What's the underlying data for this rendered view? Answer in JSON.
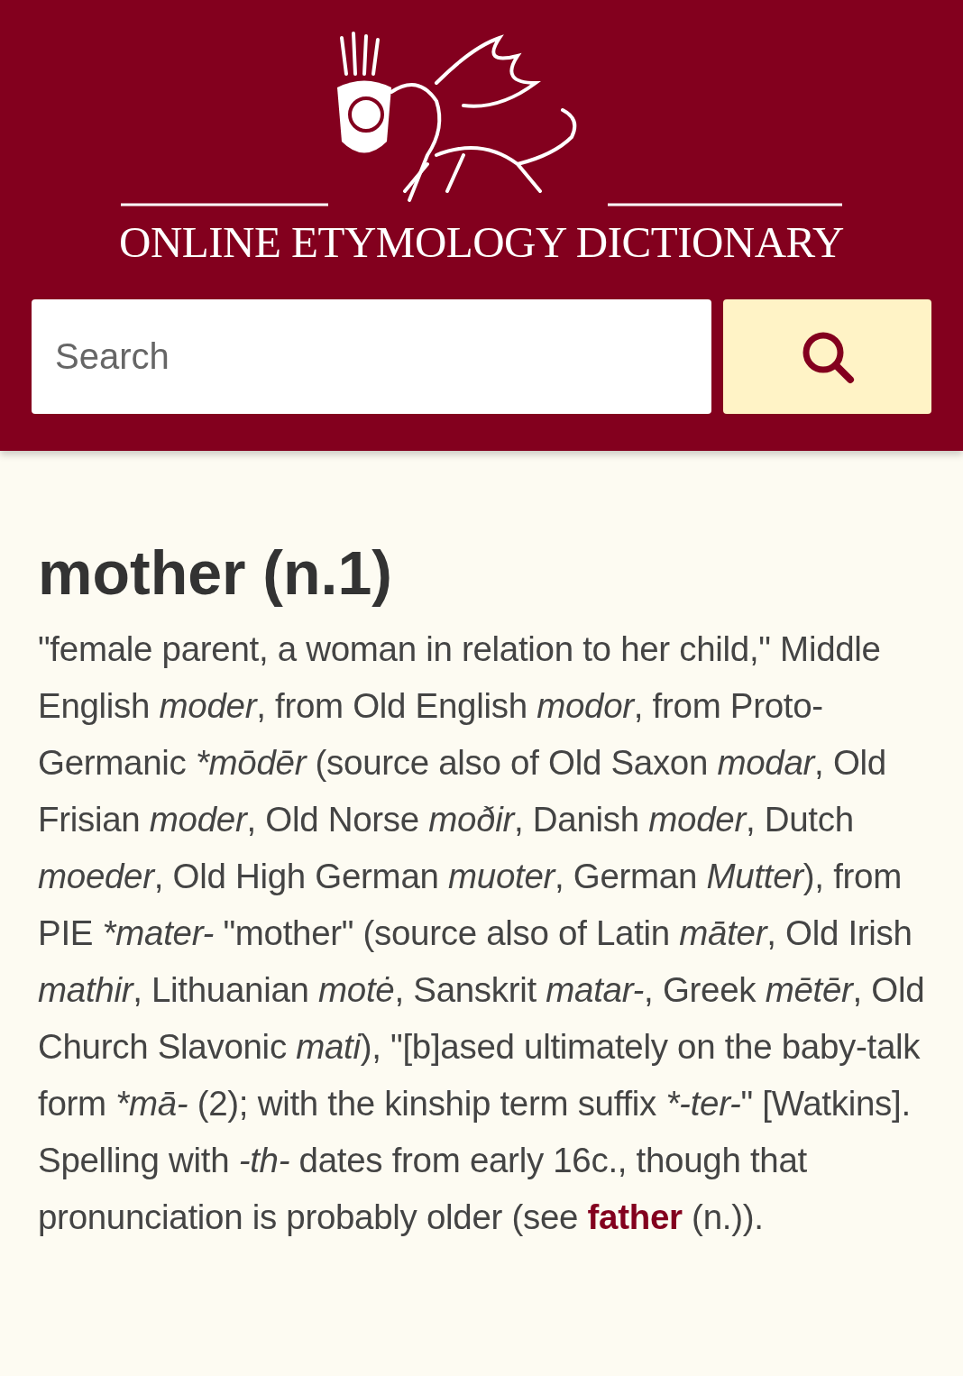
{
  "header": {
    "site_title": "ONLINE ETYMOLOGY DICTIONARY",
    "search": {
      "placeholder": "Search"
    }
  },
  "entry": {
    "heading": "mother (n.1)",
    "segments": [
      {
        "kind": "text",
        "text": "\"female parent, a woman in relation to her child,\" Middle English "
      },
      {
        "kind": "italic",
        "text": "moder"
      },
      {
        "kind": "text",
        "text": ", from Old English "
      },
      {
        "kind": "italic",
        "text": "modor"
      },
      {
        "kind": "text",
        "text": ", from Proto-Germanic "
      },
      {
        "kind": "italic",
        "text": "*mōdēr"
      },
      {
        "kind": "text",
        "text": " (source also of Old Saxon "
      },
      {
        "kind": "italic",
        "text": "modar"
      },
      {
        "kind": "text",
        "text": ", Old Frisian "
      },
      {
        "kind": "italic",
        "text": "moder"
      },
      {
        "kind": "text",
        "text": ", Old Norse "
      },
      {
        "kind": "italic",
        "text": "moðir"
      },
      {
        "kind": "text",
        "text": ", Danish "
      },
      {
        "kind": "italic",
        "text": "moder"
      },
      {
        "kind": "text",
        "text": ", Dutch "
      },
      {
        "kind": "italic",
        "text": "moeder"
      },
      {
        "kind": "text",
        "text": ", Old High German "
      },
      {
        "kind": "italic",
        "text": "muoter"
      },
      {
        "kind": "text",
        "text": ", German "
      },
      {
        "kind": "italic",
        "text": "Mutter"
      },
      {
        "kind": "text",
        "text": "), from PIE "
      },
      {
        "kind": "italic",
        "text": "*mater-"
      },
      {
        "kind": "text",
        "text": " \"mother\" (source also of Latin "
      },
      {
        "kind": "italic",
        "text": "māter"
      },
      {
        "kind": "text",
        "text": ", Old Irish "
      },
      {
        "kind": "italic",
        "text": "mathir"
      },
      {
        "kind": "text",
        "text": ", Lithuanian "
      },
      {
        "kind": "italic",
        "text": "motė"
      },
      {
        "kind": "text",
        "text": ", Sanskrit "
      },
      {
        "kind": "italic",
        "text": "matar-"
      },
      {
        "kind": "text",
        "text": ", Greek "
      },
      {
        "kind": "italic",
        "text": "mētēr"
      },
      {
        "kind": "text",
        "text": ", Old Church Slavonic "
      },
      {
        "kind": "italic",
        "text": "mati"
      },
      {
        "kind": "text",
        "text": "), \"[b]ased ultimately on the baby-talk form "
      },
      {
        "kind": "italic",
        "text": "*mā-"
      },
      {
        "kind": "text",
        "text": " (2); with the kinship term suffix "
      },
      {
        "kind": "italic",
        "text": "*-ter-"
      },
      {
        "kind": "text",
        "text": "\" [Watkins]. Spelling with "
      },
      {
        "kind": "italic",
        "text": "-th-"
      },
      {
        "kind": "text",
        "text": " dates from early 16c., though that pronunciation is probably older (see "
      },
      {
        "kind": "link",
        "text": "father"
      },
      {
        "kind": "text",
        "text": " (n.))."
      }
    ]
  }
}
